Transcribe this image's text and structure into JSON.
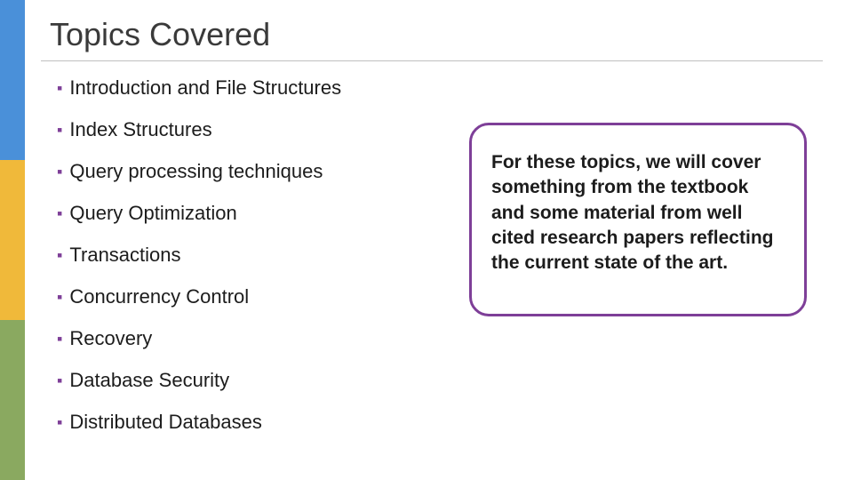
{
  "title": "Topics Covered",
  "topics": [
    "Introduction and File Structures",
    "Index Structures",
    "Query processing techniques",
    "Query Optimization",
    "Transactions",
    "Concurrency Control",
    "Recovery",
    "Database Security",
    "Distributed Databases"
  ],
  "callout": "For these topics, we will cover something from the textbook and some material from well cited research papers reflecting the current state of the art.",
  "colors": {
    "accent_purple": "#7e3f98",
    "stripe_blue": "#4a90d9",
    "stripe_yellow": "#f0b93a",
    "stripe_green": "#8aa960"
  }
}
